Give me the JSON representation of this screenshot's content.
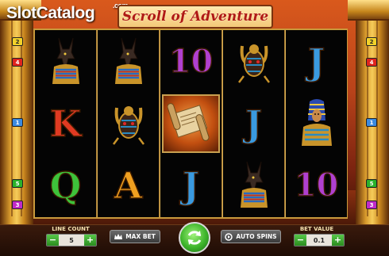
{
  "header": {
    "logo_text": "SlotCatalog",
    "logo_suffix": ".com",
    "game_title": "Scroll of Adventure"
  },
  "reels": [
    [
      {
        "symbol": "anubis",
        "icon": "anubis-icon"
      },
      {
        "symbol": "K",
        "color": "#e03a22"
      },
      {
        "symbol": "Q",
        "color": "#3ec23a"
      }
    ],
    [
      {
        "symbol": "anubis",
        "icon": "anubis-icon"
      },
      {
        "symbol": "scarab",
        "icon": "scarab-icon"
      },
      {
        "symbol": "A",
        "color": "#f0a020"
      }
    ],
    [
      {
        "symbol": "10",
        "color": "#b040d0"
      },
      {
        "symbol": "scroll",
        "icon": "scroll-icon"
      },
      {
        "symbol": "J",
        "color": "#3a9ae0"
      }
    ],
    [
      {
        "symbol": "scarab",
        "icon": "scarab-icon"
      },
      {
        "symbol": "J",
        "color": "#3a9ae0"
      },
      {
        "symbol": "anubis",
        "icon": "anubis-icon"
      }
    ],
    [
      {
        "symbol": "J",
        "color": "#3a9ae0"
      },
      {
        "symbol": "pharaoh",
        "icon": "pharaoh-icon"
      },
      {
        "symbol": "10",
        "color": "#b040d0"
      }
    ]
  ],
  "paylines": {
    "left": [
      {
        "label": "2",
        "color": "#f2d22a"
      },
      {
        "label": "4",
        "color": "#e0241e"
      },
      {
        "label": "1",
        "color": "#3a8ae0"
      },
      {
        "label": "5",
        "color": "#2ab22a"
      },
      {
        "label": "3",
        "color": "#c02ac8"
      }
    ],
    "right": [
      {
        "label": "2",
        "color": "#f2d22a"
      },
      {
        "label": "4",
        "color": "#e0241e"
      },
      {
        "label": "1",
        "color": "#3a8ae0"
      },
      {
        "label": "5",
        "color": "#2ab22a"
      },
      {
        "label": "3",
        "color": "#c02ac8"
      }
    ]
  },
  "controls": {
    "line_count_label": "LINE COUNT",
    "line_count_value": "5",
    "minus": "−",
    "plus": "+",
    "max_bet_label": "MAX BET",
    "auto_spins_label": "AUTO SPINS",
    "bet_value_label": "BET VALUE",
    "bet_value": "0.1"
  }
}
